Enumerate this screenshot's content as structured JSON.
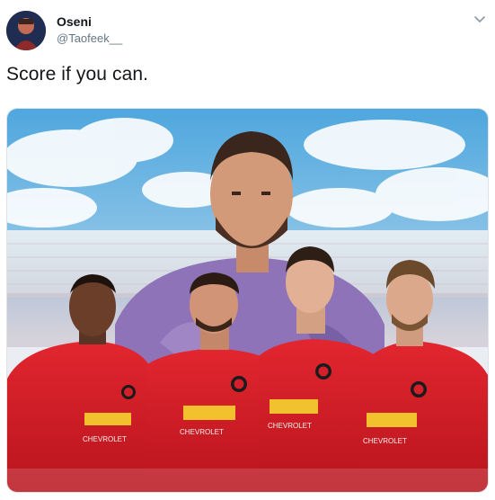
{
  "tweet": {
    "author_name": "Oseni",
    "author_handle": "@Taofeek__",
    "text": "Score if you can."
  },
  "media": {
    "jersey_sponsor": "CHEVROLET",
    "description_icon": "photo"
  },
  "colors": {
    "sky": "#5aaede",
    "jersey_red": "#d3202a",
    "goalkeeper_purple": "#8a6db5",
    "text_primary": "#14171a",
    "text_secondary": "#657786"
  }
}
